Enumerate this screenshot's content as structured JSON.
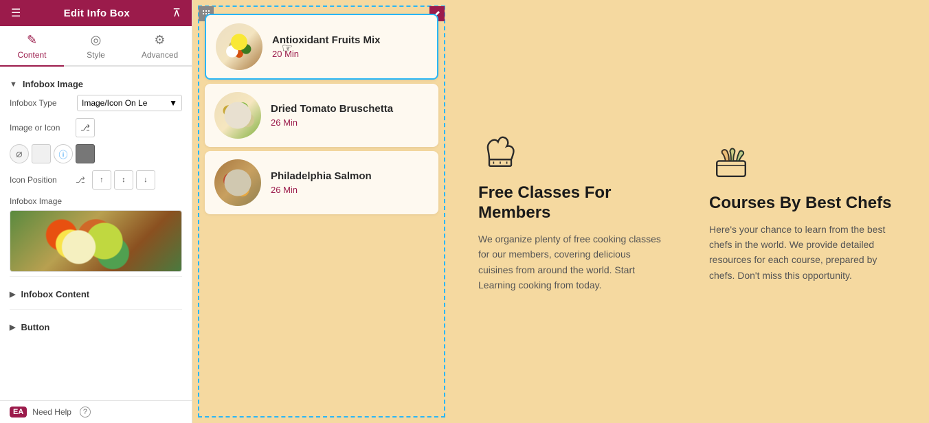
{
  "header": {
    "title": "Edit Info Box",
    "hamburger_icon": "≡",
    "grid_icon": "⊞"
  },
  "tabs": [
    {
      "id": "content",
      "label": "Content",
      "icon": "✏️",
      "active": true
    },
    {
      "id": "style",
      "label": "Style",
      "icon": "◎",
      "active": false
    },
    {
      "id": "advanced",
      "label": "Advanced",
      "icon": "⚙",
      "active": false
    }
  ],
  "panel": {
    "infobox_image_section": "Infobox Image",
    "infobox_type_label": "Infobox Type",
    "infobox_type_value": "Image/Icon On Le",
    "image_or_icon_label": "Image or Icon",
    "icon_position_label": "Icon Position",
    "infobox_image_label": "Infobox Image",
    "infobox_content_section": "Infobox Content",
    "button_section": "Button"
  },
  "footer": {
    "badge": "EA",
    "need_help": "Need Help",
    "help_icon": "?"
  },
  "recipes": [
    {
      "title": "Antioxidant Fruits Mix",
      "time": "20 Min",
      "active": true
    },
    {
      "title": "Dried Tomato Bruschetta",
      "time": "26 Min",
      "active": false
    },
    {
      "title": "Philadelphia Salmon",
      "time": "26 Min",
      "active": false
    }
  ],
  "info_boxes": [
    {
      "icon_type": "chef_hat",
      "title": "Free Classes For Members",
      "description": "We organize plenty of free cooking classes for our members, covering delicious cuisines from around the world. Start Learning cooking from today."
    },
    {
      "icon_type": "basket",
      "title": "Courses By Best Chefs",
      "description": "Here's your chance to learn from the best chefs in the world. We provide detailed resources for each course, prepared by chefs. Don't miss this opportunity."
    }
  ]
}
